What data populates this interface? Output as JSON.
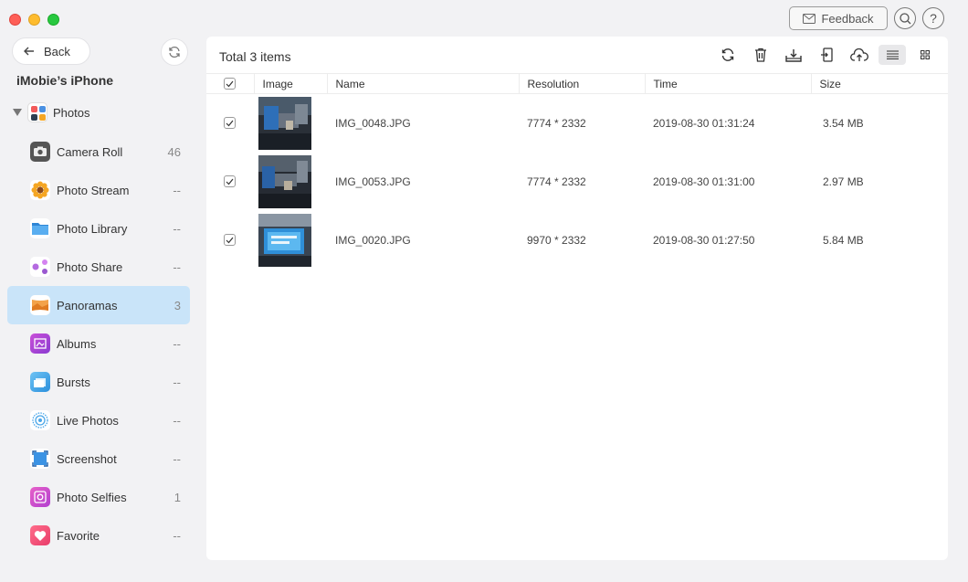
{
  "window": {
    "feedback_label": "Feedback"
  },
  "sidebar": {
    "back_label": "Back",
    "device_name": "iMobie’s iPhone",
    "group_label": "Photos",
    "items": [
      {
        "label": "Camera Roll",
        "count": "46",
        "icon": "camera-icon"
      },
      {
        "label": "Photo Stream",
        "count": "--",
        "icon": "sunflower-icon"
      },
      {
        "label": "Photo Library",
        "count": "--",
        "icon": "folder-icon"
      },
      {
        "label": "Photo Share",
        "count": "--",
        "icon": "share-icon"
      },
      {
        "label": "Panoramas",
        "count": "3",
        "icon": "panorama-icon",
        "active": true
      },
      {
        "label": "Albums",
        "count": "--",
        "icon": "album-icon"
      },
      {
        "label": "Bursts",
        "count": "--",
        "icon": "burst-icon"
      },
      {
        "label": "Live Photos",
        "count": "--",
        "icon": "live-photo-icon"
      },
      {
        "label": "Screenshot",
        "count": "--",
        "icon": "screenshot-icon"
      },
      {
        "label": "Photo Selfies",
        "count": "1",
        "icon": "selfie-icon"
      },
      {
        "label": "Favorite",
        "count": "--",
        "icon": "heart-icon"
      }
    ]
  },
  "main": {
    "title": "Total 3 items",
    "columns": [
      "Image",
      "Name",
      "Resolution",
      "Time",
      "Size"
    ],
    "rows": [
      {
        "name": "IMG_0048.JPG",
        "resolution": "7774 * 2332",
        "time": "2019-08-30 01:31:24",
        "size": "3.54 MB"
      },
      {
        "name": "IMG_0053.JPG",
        "resolution": "7774 * 2332",
        "time": "2019-08-30 01:31:00",
        "size": "2.97 MB"
      },
      {
        "name": "IMG_0020.JPG",
        "resolution": "9970 * 2332",
        "time": "2019-08-30 01:27:50",
        "size": "5.84 MB"
      }
    ]
  }
}
